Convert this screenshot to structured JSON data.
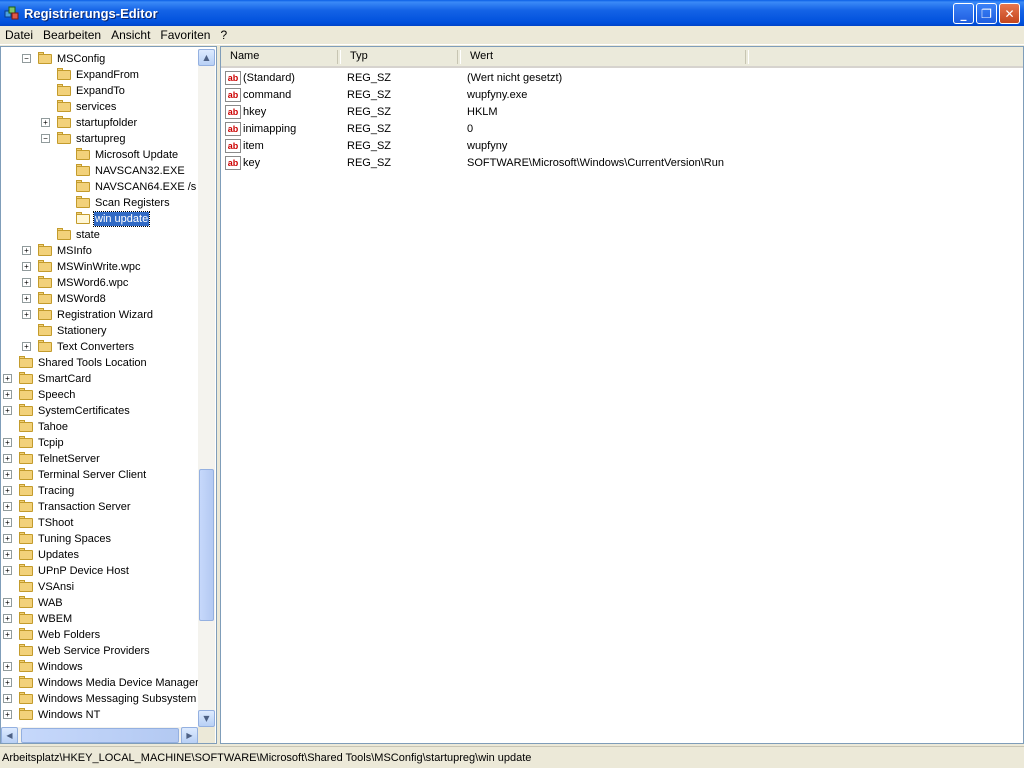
{
  "window": {
    "title": "Registrierungs-Editor",
    "minimize_label": "_",
    "maximize_label": "❐",
    "close_label": "✕"
  },
  "menu": {
    "items": [
      "Datei",
      "Bearbeiten",
      "Ansicht",
      "Favoriten",
      "?"
    ]
  },
  "tree": {
    "rows": [
      {
        "label": "MSConfig",
        "expander": "−",
        "open": false,
        "selected": false
      },
      {
        "label": "ExpandFrom",
        "expander": "",
        "open": false,
        "selected": false
      },
      {
        "label": "ExpandTo",
        "expander": "",
        "open": false,
        "selected": false
      },
      {
        "label": "services",
        "expander": "",
        "open": false,
        "selected": false
      },
      {
        "label": "startupfolder",
        "expander": "+",
        "open": false,
        "selected": false
      },
      {
        "label": "startupreg",
        "expander": "−",
        "open": false,
        "selected": false
      },
      {
        "label": "Microsoft Update",
        "expander": "",
        "open": false,
        "selected": false
      },
      {
        "label": "NAVSCAN32.EXE",
        "expander": "",
        "open": false,
        "selected": false
      },
      {
        "label": "NAVSCAN64.EXE /s",
        "expander": "",
        "open": false,
        "selected": false
      },
      {
        "label": "Scan Registers",
        "expander": "",
        "open": false,
        "selected": false
      },
      {
        "label": "win update",
        "expander": "",
        "open": true,
        "selected": true
      },
      {
        "label": "state",
        "expander": "",
        "open": false,
        "selected": false
      },
      {
        "label": "MSInfo",
        "expander": "+",
        "open": false,
        "selected": false
      },
      {
        "label": "MSWinWrite.wpc",
        "expander": "+",
        "open": false,
        "selected": false
      },
      {
        "label": "MSWord6.wpc",
        "expander": "+",
        "open": false,
        "selected": false
      },
      {
        "label": "MSWord8",
        "expander": "+",
        "open": false,
        "selected": false
      },
      {
        "label": "Registration Wizard",
        "expander": "+",
        "open": false,
        "selected": false
      },
      {
        "label": "Stationery",
        "expander": "",
        "open": false,
        "selected": false
      },
      {
        "label": "Text Converters",
        "expander": "+",
        "open": false,
        "selected": false
      },
      {
        "label": "Shared Tools Location",
        "expander": "",
        "open": false,
        "selected": false
      },
      {
        "label": "SmartCard",
        "expander": "+",
        "open": false,
        "selected": false
      },
      {
        "label": "Speech",
        "expander": "+",
        "open": false,
        "selected": false
      },
      {
        "label": "SystemCertificates",
        "expander": "+",
        "open": false,
        "selected": false
      },
      {
        "label": "Tahoe",
        "expander": "",
        "open": false,
        "selected": false
      },
      {
        "label": "Tcpip",
        "expander": "+",
        "open": false,
        "selected": false
      },
      {
        "label": "TelnetServer",
        "expander": "+",
        "open": false,
        "selected": false
      },
      {
        "label": "Terminal Server Client",
        "expander": "+",
        "open": false,
        "selected": false
      },
      {
        "label": "Tracing",
        "expander": "+",
        "open": false,
        "selected": false
      },
      {
        "label": "Transaction Server",
        "expander": "+",
        "open": false,
        "selected": false
      },
      {
        "label": "TShoot",
        "expander": "+",
        "open": false,
        "selected": false
      },
      {
        "label": "Tuning Spaces",
        "expander": "+",
        "open": false,
        "selected": false
      },
      {
        "label": "Updates",
        "expander": "+",
        "open": false,
        "selected": false
      },
      {
        "label": "UPnP Device Host",
        "expander": "+",
        "open": false,
        "selected": false
      },
      {
        "label": "VSAnsi",
        "expander": "",
        "open": false,
        "selected": false
      },
      {
        "label": "WAB",
        "expander": "+",
        "open": false,
        "selected": false
      },
      {
        "label": "WBEM",
        "expander": "+",
        "open": false,
        "selected": false
      },
      {
        "label": "Web Folders",
        "expander": "+",
        "open": false,
        "selected": false
      },
      {
        "label": "Web Service Providers",
        "expander": "",
        "open": false,
        "selected": false
      },
      {
        "label": "Windows",
        "expander": "+",
        "open": false,
        "selected": false
      },
      {
        "label": "Windows Media Device Manager",
        "expander": "+",
        "open": false,
        "selected": false
      },
      {
        "label": "Windows Messaging Subsystem",
        "expander": "+",
        "open": false,
        "selected": false
      },
      {
        "label": "Windows NT",
        "expander": "+",
        "open": false,
        "selected": false
      }
    ]
  },
  "list": {
    "columns": [
      "Name",
      "Typ",
      "Wert"
    ],
    "rows": [
      {
        "icon": "ab",
        "name": "(Standard)",
        "type": "REG_SZ",
        "value": "(Wert nicht gesetzt)"
      },
      {
        "icon": "ab",
        "name": "command",
        "type": "REG_SZ",
        "value": "wupfyny.exe"
      },
      {
        "icon": "ab",
        "name": "hkey",
        "type": "REG_SZ",
        "value": "HKLM"
      },
      {
        "icon": "ab",
        "name": "inimapping",
        "type": "REG_SZ",
        "value": "0"
      },
      {
        "icon": "ab",
        "name": "item",
        "type": "REG_SZ",
        "value": "wupfyny"
      },
      {
        "icon": "ab",
        "name": "key",
        "type": "REG_SZ",
        "value": "SOFTWARE\\Microsoft\\Windows\\CurrentVersion\\Run"
      }
    ]
  },
  "statusbar": {
    "path": "Arbeitsplatz\\HKEY_LOCAL_MACHINE\\SOFTWARE\\Microsoft\\Shared Tools\\MSConfig\\startupreg\\win update"
  },
  "icons": {
    "app": "registry-editor-icon",
    "folder": "folder-icon",
    "value": "string-value-icon"
  },
  "colors": {
    "titlebar": "#0a5ee6",
    "selection": "#316ac5",
    "folder": "#f2d17a"
  }
}
